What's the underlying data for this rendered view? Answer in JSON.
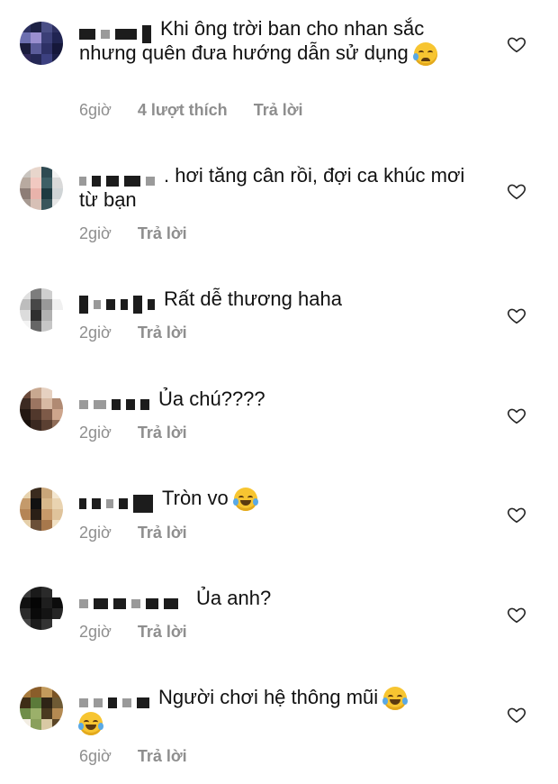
{
  "comments": [
    {
      "text": "Khi ông trời ban cho nhan sắc nhưng quên đưa hướng dẫn sử dụng",
      "emoji": "crying-face",
      "time": "6giờ",
      "likes": "4 lượt thích",
      "reply": "Trả lời"
    },
    {
      "text": ". hơi tăng cân rồi, đợi ca khúc mơi từ bạn",
      "time": "2giờ",
      "reply": "Trả lời"
    },
    {
      "text": "Rất dễ thương haha",
      "time": "2giờ",
      "reply": "Trả lời"
    },
    {
      "text": "Ủa chú????",
      "time": "2giờ",
      "reply": "Trả lời"
    },
    {
      "text": "Tròn vo",
      "emoji": "tears-of-joy",
      "time": "2giờ",
      "reply": "Trả lời"
    },
    {
      "text": "Ủa anh?",
      "time": "2giờ",
      "reply": "Trả lời"
    },
    {
      "text": "Người chơi hệ thông mũi",
      "emoji": "tears-of-joy",
      "time": "6giờ",
      "reply": "Trả lời"
    }
  ],
  "icons": {
    "like": "heart-outline-icon",
    "crying": "crying-face-emoji",
    "laughing": "tears-of-joy-emoji"
  },
  "colors": {
    "text": "#111111",
    "meta": "#8e8e8e",
    "background": "#ffffff"
  }
}
